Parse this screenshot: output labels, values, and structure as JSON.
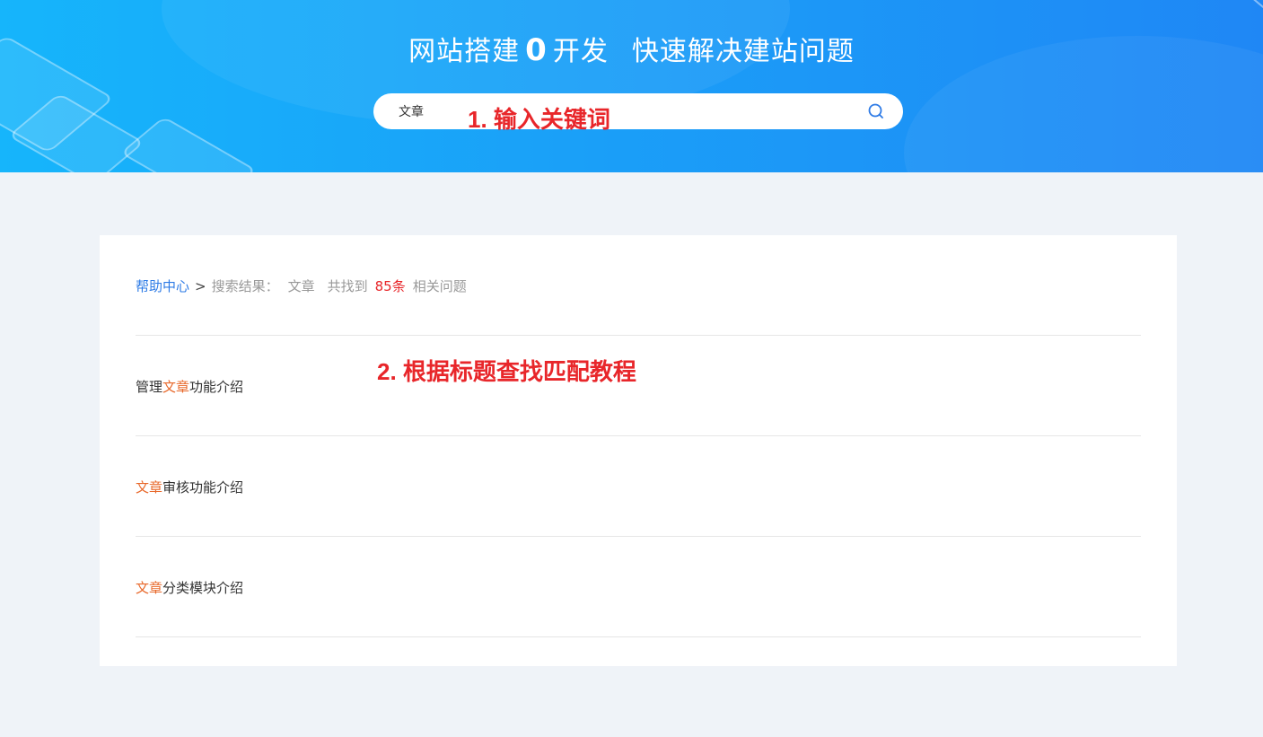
{
  "banner": {
    "title_part1": "网站搭建",
    "title_zero": "0",
    "title_part2": "开发",
    "title_part3": "快速解决建站问题"
  },
  "search": {
    "value": "文章"
  },
  "annotations": {
    "step1": "1. 输入关键词",
    "step2": "2. 根据标题查找匹配教程"
  },
  "breadcrumb": {
    "home": "帮助中心",
    "separator": ">",
    "label": "搜索结果：",
    "keyword": "文章",
    "found": "共找到",
    "count": "85条",
    "tail": "相关问题"
  },
  "results": [
    {
      "before": "管理",
      "highlight": "文章",
      "after": "功能介绍"
    },
    {
      "before": "",
      "highlight": "文章",
      "after": "审核功能介绍"
    },
    {
      "before": "",
      "highlight": "文章",
      "after": "分类模块介绍"
    }
  ],
  "colors": {
    "accent": "#2e7be6",
    "highlight": "#e8682a",
    "annotation": "#e8262a",
    "banner_start": "#16b5fb",
    "banner_end": "#1f87f5"
  },
  "icons": {
    "search": "search-icon"
  }
}
